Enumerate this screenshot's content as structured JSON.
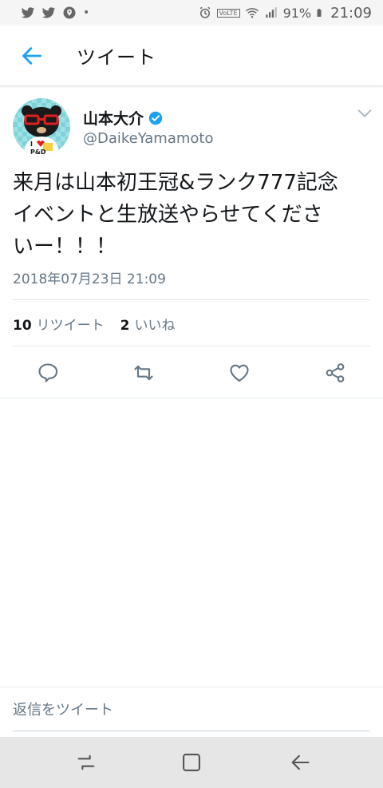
{
  "status_bar": {
    "battery": "91%",
    "time": "21:09",
    "volte": "VoLTE"
  },
  "header": {
    "title": "ツイート"
  },
  "tweet": {
    "author_name": "山本大介",
    "author_handle": "@DaikeYamamoto",
    "text": "来月は山本初王冠&ランク777記念\nイベントと生放送やらせてくださ\nいー！！！",
    "timestamp": "2018年07月23日 21:09",
    "retweet_count": "10",
    "retweet_label": "リツイート",
    "like_count": "2",
    "like_label": "いいね"
  },
  "reply": {
    "placeholder": "返信をツイート"
  },
  "colors": {
    "accent": "#1da1f2",
    "icon_gray": "#657786"
  }
}
